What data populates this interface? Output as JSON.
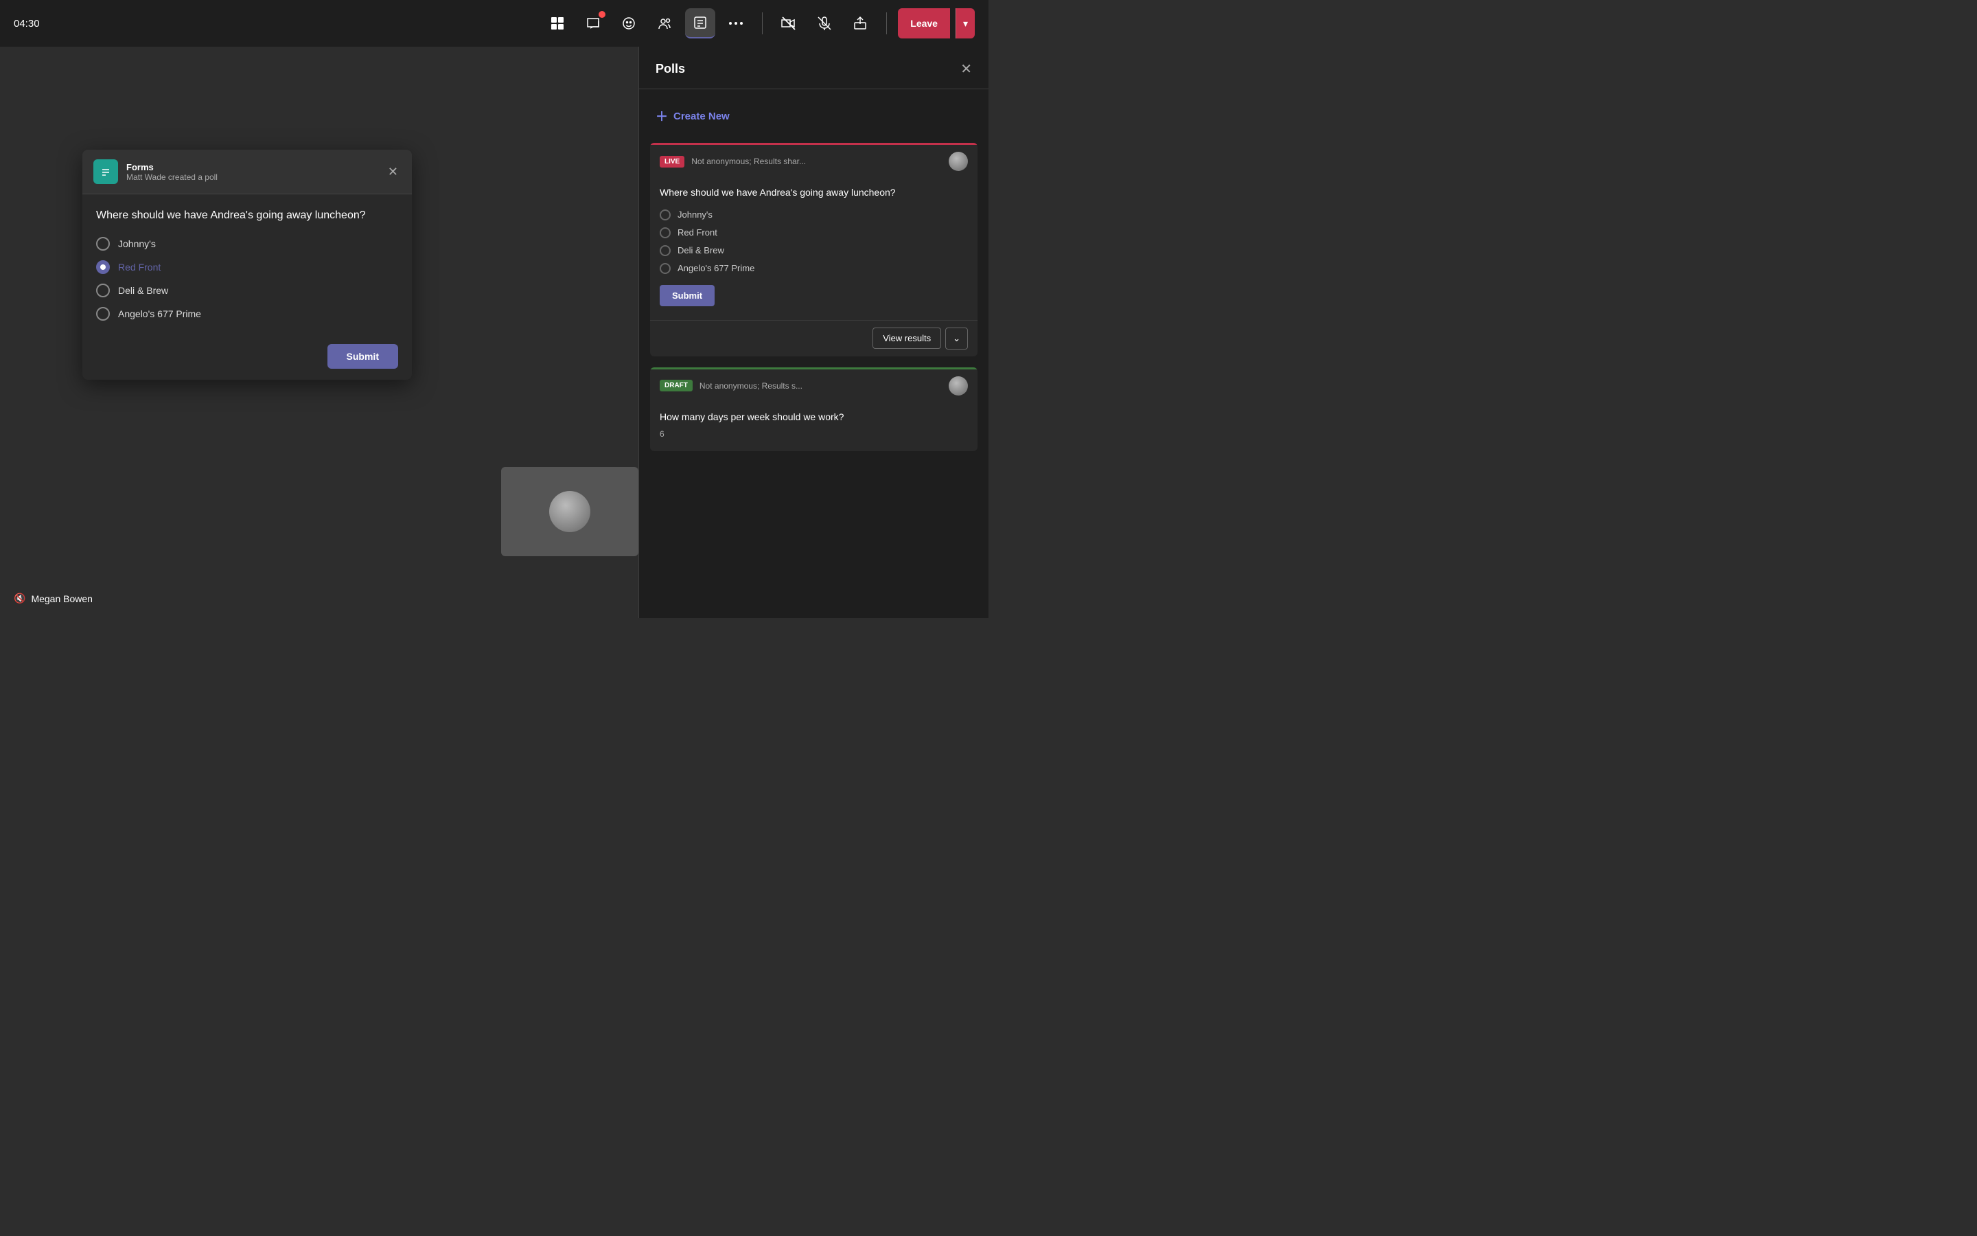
{
  "topbar": {
    "time": "04:30",
    "icons": [
      {
        "name": "apps-icon",
        "symbol": "⊞",
        "badge": false
      },
      {
        "name": "chat-icon",
        "symbol": "💬",
        "badge": true
      },
      {
        "name": "emoji-icon",
        "symbol": "☺",
        "badge": false
      },
      {
        "name": "participants-icon",
        "symbol": "👥",
        "badge": false
      },
      {
        "name": "forms-icon",
        "symbol": "📋",
        "badge": false,
        "active": true
      },
      {
        "name": "more-icon",
        "symbol": "···",
        "badge": false
      }
    ],
    "media_icons": [
      {
        "name": "video-off-icon",
        "symbol": "📷"
      },
      {
        "name": "mic-off-icon",
        "symbol": "🎤"
      },
      {
        "name": "share-icon",
        "symbol": "⬆"
      }
    ],
    "leave_label": "Leave"
  },
  "poll_popup": {
    "app_name": "Forms",
    "subtitle": "Matt Wade created a poll",
    "question": "Where should we have Andrea's going away luncheon?",
    "options": [
      {
        "label": "Johnny's",
        "selected": false
      },
      {
        "label": "Red Front",
        "selected": true
      },
      {
        "label": "Deli & Brew",
        "selected": false
      },
      {
        "label": "Angelo's 677 Prime",
        "selected": false
      }
    ],
    "submit_label": "Submit"
  },
  "polls_panel": {
    "title": "Polls",
    "close_label": "×",
    "create_new_label": "Create New",
    "live_poll": {
      "badge": "LIVE",
      "meta": "Not anonymous; Results shar...",
      "question": "Where should we have Andrea's going away luncheon?",
      "options": [
        {
          "label": "Johnny's"
        },
        {
          "label": "Red Front"
        },
        {
          "label": "Deli & Brew"
        },
        {
          "label": "Angelo's 677 Prime"
        }
      ],
      "submit_label": "Submit",
      "view_results_label": "View results",
      "expand_label": "⌄"
    },
    "draft_poll": {
      "badge": "DRAFT",
      "meta": "Not anonymous; Results s...",
      "question": "How many days per week should we work?",
      "answer_count": "6"
    }
  },
  "bottom": {
    "user_name": "Megan Bowen",
    "mic_icon": "🔇"
  }
}
